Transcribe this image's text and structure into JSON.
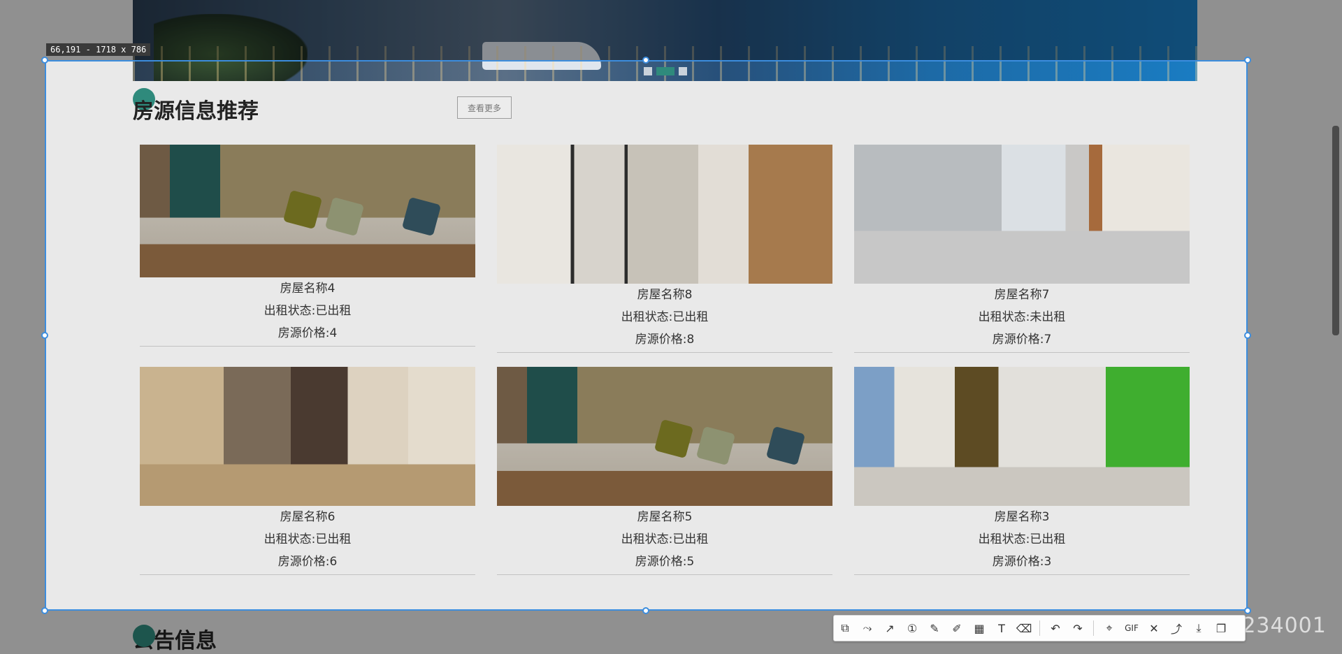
{
  "selection_info": "66,191 - 1718 x 786",
  "section": {
    "title": "房源信息推荐",
    "more_button": "查看更多"
  },
  "houses": [
    {
      "name": "房屋名称4",
      "status": "出租状态:已出租",
      "price": "房源价格:4"
    },
    {
      "name": "房屋名称8",
      "status": "出租状态:已出租",
      "price": "房源价格:8"
    },
    {
      "name": "房屋名称7",
      "status": "出租状态:未出租",
      "price": "房源价格:7"
    },
    {
      "name": "房屋名称6",
      "status": "出租状态:已出租",
      "price": "房源价格:6"
    },
    {
      "name": "房屋名称5",
      "status": "出租状态:已出租",
      "price": "房源价格:5"
    },
    {
      "name": "房屋名称3",
      "status": "出租状态:已出租",
      "price": "房源价格:3"
    }
  ],
  "next_section": {
    "title": "公告信息"
  },
  "watermark": "CSDN @qq_36234001",
  "toolbar": {
    "tools": [
      "shape-icon",
      "polyline-icon",
      "arrow-icon",
      "number-icon",
      "pen-icon",
      "highlighter-icon",
      "mosaic-icon",
      "text-icon",
      "eraser-icon",
      "undo-icon",
      "redo-icon",
      "gif-icon",
      "cancel-icon",
      "pin-icon",
      "download-icon",
      "copy-icon"
    ],
    "gif_label": "GIF"
  }
}
